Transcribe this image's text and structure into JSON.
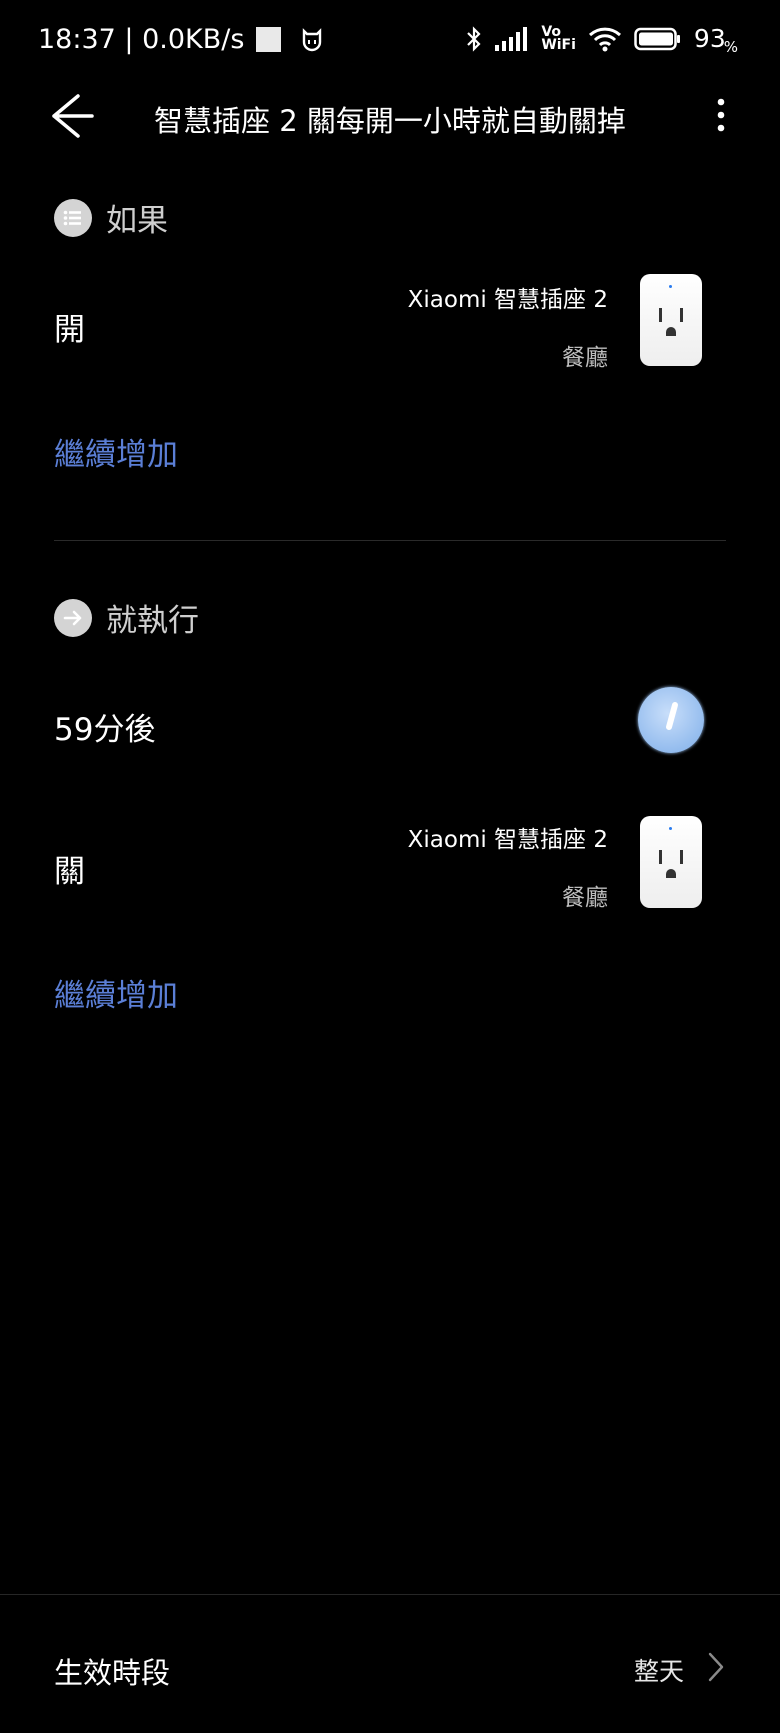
{
  "status_bar": {
    "time_speed": "18:37 | 0.0KB/s",
    "battery_value": "93",
    "battery_unit": "%",
    "vowifi_top": "Vo",
    "vowifi_bottom": "WiFi"
  },
  "header": {
    "title": "智慧插座 2 關每開一小時就自動關掉"
  },
  "if_section": {
    "label": "如果",
    "condition": {
      "label": "開",
      "device_name": "Xiaomi 智慧插座 2",
      "room": "餐廳"
    },
    "add_more": "繼續增加"
  },
  "then_section": {
    "label": "就執行",
    "delay": {
      "label": "59分後"
    },
    "action": {
      "label": "關",
      "device_name": "Xiaomi 智慧插座 2",
      "room": "餐廳"
    },
    "add_more": "繼續增加"
  },
  "effective_period": {
    "label": "生效時段",
    "value": "整天"
  },
  "colors": {
    "accent_link": "#5b7fd6",
    "background": "#000000",
    "timer_blue": "#7eaee9"
  },
  "icons": {
    "back": "arrow-left-icon",
    "more": "more-vertical-icon",
    "if": "list-icon",
    "then": "arrow-right-circle-icon",
    "timer": "timer-icon",
    "device": "smart-plug-icon",
    "chevron": "chevron-right-icon"
  }
}
